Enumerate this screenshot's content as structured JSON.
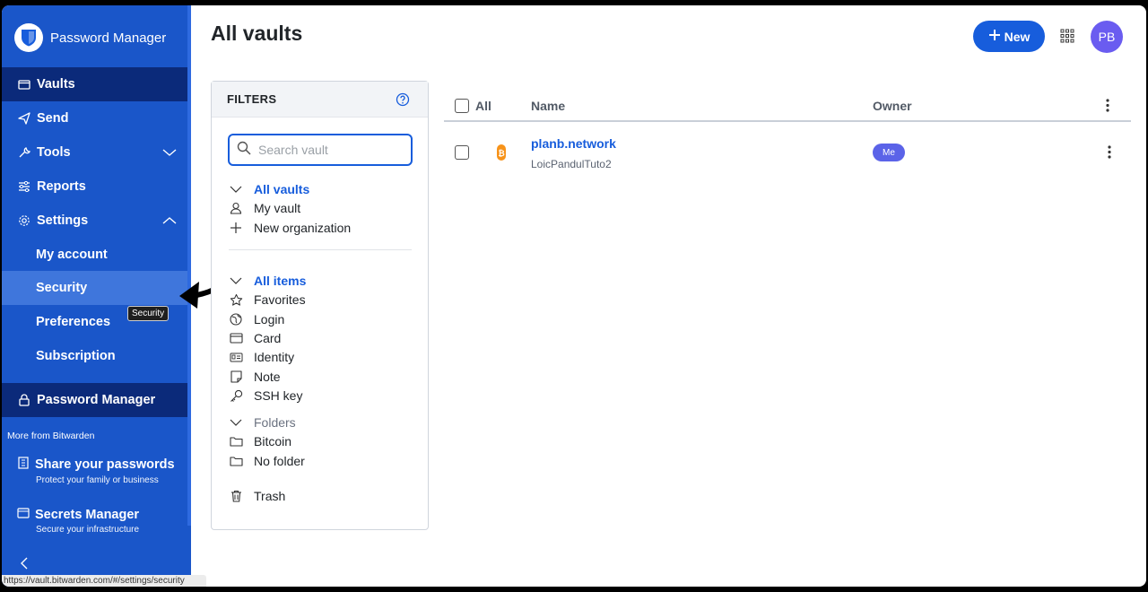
{
  "sidebar": {
    "brand": "Password Manager",
    "items": [
      {
        "label": "Vaults"
      },
      {
        "label": "Send"
      },
      {
        "label": "Tools"
      },
      {
        "label": "Reports"
      },
      {
        "label": "Settings"
      }
    ],
    "settings_sub": [
      {
        "label": "My account"
      },
      {
        "label": "Security"
      },
      {
        "label": "Preferences"
      },
      {
        "label": "Subscription"
      }
    ],
    "product_switcher": "Password Manager",
    "tooltip": "Security",
    "more_label": "More from Bitwarden",
    "promos": [
      {
        "title": "Share your passwords",
        "subtitle": "Protect your family or business"
      },
      {
        "title": "Secrets Manager",
        "subtitle": "Secure your infrastructure"
      }
    ],
    "status_url": "https://vault.bitwarden.com/#/settings/security"
  },
  "header": {
    "title": "All vaults",
    "new_label": "New",
    "avatar_initials": "PB"
  },
  "filters": {
    "title": "FILTERS",
    "search_placeholder": "Search vault",
    "vaults": [
      {
        "label": "All vaults"
      },
      {
        "label": "My vault"
      },
      {
        "label": "New organization"
      }
    ],
    "types": [
      {
        "label": "All items"
      },
      {
        "label": "Favorites"
      },
      {
        "label": "Login"
      },
      {
        "label": "Card"
      },
      {
        "label": "Identity"
      },
      {
        "label": "Note"
      },
      {
        "label": "SSH key"
      }
    ],
    "folders_label": "Folders",
    "folders": [
      {
        "label": "Bitcoin"
      },
      {
        "label": "No folder"
      }
    ],
    "trash": "Trash"
  },
  "table": {
    "col_all": "All",
    "col_name": "Name",
    "col_owner": "Owner",
    "rows": [
      {
        "name": "planb.network",
        "username": "LoicPandulTuto2",
        "owner": "Me"
      }
    ]
  },
  "colors": {
    "sidebar": "#1a56c9",
    "active": "#0b2a7a",
    "accent": "#175ddc",
    "avatar": "#6a5cf0",
    "badge": "#5b63e8"
  }
}
